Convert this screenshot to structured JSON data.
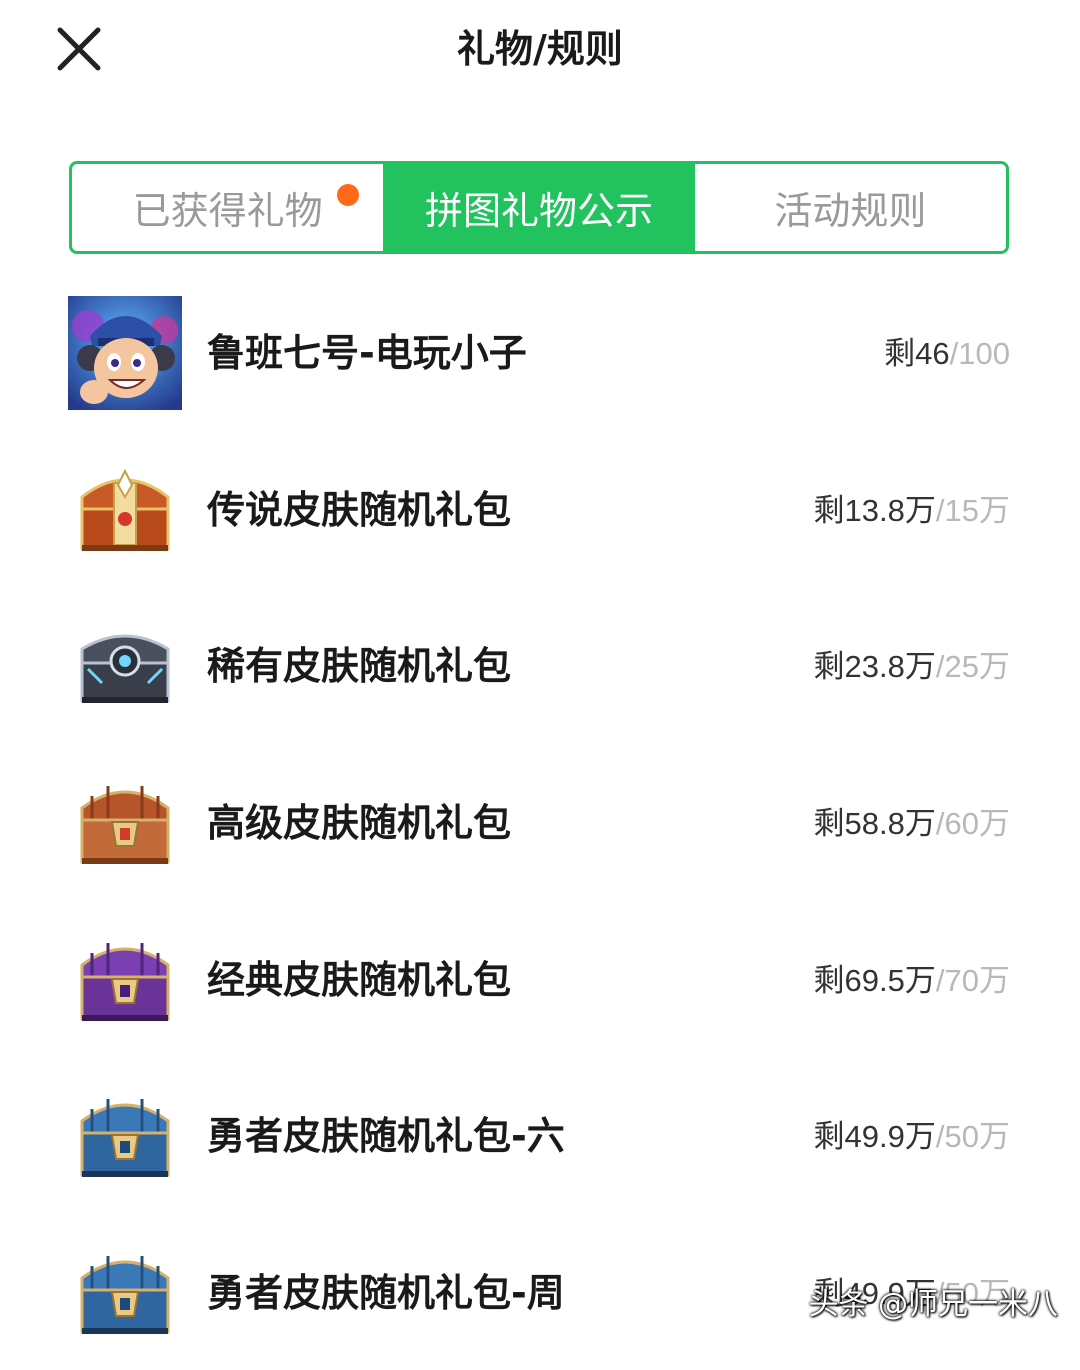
{
  "header": {
    "title": "礼物/规则"
  },
  "tabs": [
    {
      "label": "已获得礼物",
      "active": false,
      "has_dot": true
    },
    {
      "label": "拼图礼物公示",
      "active": true,
      "has_dot": false
    },
    {
      "label": "活动规则",
      "active": false,
      "has_dot": false
    }
  ],
  "gifts": [
    {
      "name": "鲁班七号-电玩小子",
      "remain": "剩46",
      "total": "/100",
      "icon": "hero-avatar-icon"
    },
    {
      "name": "传说皮肤随机礼包",
      "remain": "剩13.8万",
      "total": "/15万",
      "icon": "legendary-chest-icon"
    },
    {
      "name": "稀有皮肤随机礼包",
      "remain": "剩23.8万",
      "total": "/25万",
      "icon": "rare-chest-icon"
    },
    {
      "name": "高级皮肤随机礼包",
      "remain": "剩58.8万",
      "total": "/60万",
      "icon": "advanced-chest-icon"
    },
    {
      "name": "经典皮肤随机礼包",
      "remain": "剩69.5万",
      "total": "/70万",
      "icon": "classic-chest-icon"
    },
    {
      "name": "勇者皮肤随机礼包-六",
      "remain": "剩49.9万",
      "total": "/50万",
      "icon": "warrior-chest-icon"
    },
    {
      "name": "勇者皮肤随机礼包-周",
      "remain": "剩49.9万",
      "total": "/50万",
      "icon": "warrior-chest-icon"
    }
  ],
  "watermark": "头条 @师兄一米八",
  "colors": {
    "accent": "#22c35e",
    "dot": "#ff6a1a"
  }
}
